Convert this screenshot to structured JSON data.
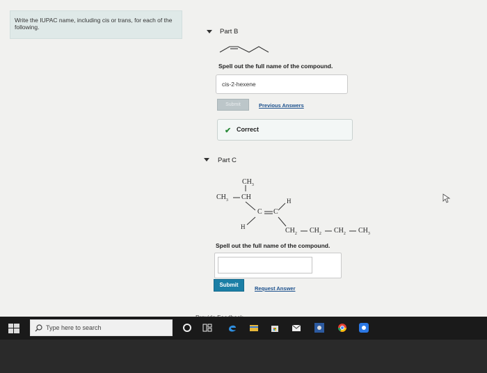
{
  "instructions": "Write the IUPAC name, including cis or trans, for each of the following.",
  "part_b": {
    "title": "Part B",
    "prompt": "Spell out the full name of the compound.",
    "answer_value": "cis-2-hexene",
    "submit_label": "Submit",
    "previous_answers_label": "Previous Answers",
    "feedback_status": "Correct"
  },
  "part_c": {
    "title": "Part C",
    "prompt": "Spell out the full name of the compound.",
    "answer_value": "",
    "submit_label": "Submit",
    "request_answer_label": "Request Answer",
    "structure": {
      "top_ch3": "CH",
      "top_ch3_sub": "3",
      "left_ch3": "CH",
      "left_ch3_sub": "3",
      "left_ch": "CH",
      "h_right": "H",
      "c_left": "C",
      "c_right": "C",
      "h_left": "H",
      "chain": [
        {
          "t": "CH",
          "s": "2"
        },
        {
          "t": "CH",
          "s": "2"
        },
        {
          "t": "CH",
          "s": "2"
        },
        {
          "t": "CH",
          "s": "3"
        }
      ]
    }
  },
  "provide_feedback": "Provide Feedback",
  "taskbar": {
    "search_placeholder": "Type here to search",
    "icons": [
      "windows-start-icon",
      "cortana-circle-icon",
      "task-view-icon",
      "edge-browser-icon",
      "file-explorer-icon",
      "store-bag-icon",
      "mail-icon",
      "camera-icon",
      "chrome-icon",
      "app-icon"
    ]
  },
  "colors": {
    "accent_button": "#1b7fa6",
    "correct_check": "#2b8a3a",
    "link": "#1a4f8c"
  }
}
